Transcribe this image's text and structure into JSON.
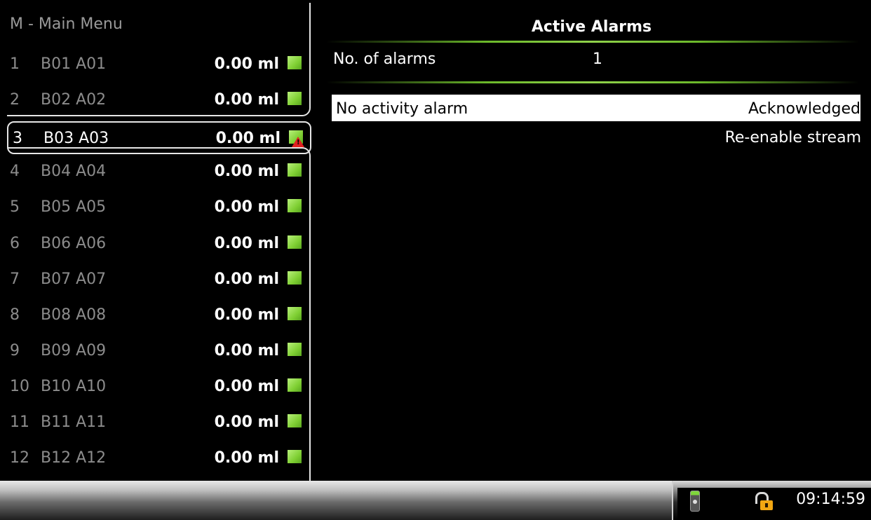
{
  "menu": {
    "title": "M - Main Menu",
    "items": [
      {
        "num": "1",
        "name": "B01 A01",
        "volume": "0.00 ml",
        "status": "ok"
      },
      {
        "num": "2",
        "name": "B02 A02",
        "volume": "0.00 ml",
        "status": "ok"
      },
      {
        "num": "3",
        "name": "B03 A03",
        "volume": "0.00 ml",
        "status": "alarm",
        "selected": true
      },
      {
        "num": "4",
        "name": "B04 A04",
        "volume": "0.00 ml",
        "status": "ok"
      },
      {
        "num": "5",
        "name": "B05 A05",
        "volume": "0.00 ml",
        "status": "ok"
      },
      {
        "num": "6",
        "name": "B06 A06",
        "volume": "0.00 ml",
        "status": "ok"
      },
      {
        "num": "7",
        "name": "B07 A07",
        "volume": "0.00 ml",
        "status": "ok"
      },
      {
        "num": "8",
        "name": "B08 A08",
        "volume": "0.00 ml",
        "status": "ok"
      },
      {
        "num": "9",
        "name": "B09 A09",
        "volume": "0.00 ml",
        "status": "ok"
      },
      {
        "num": "10",
        "name": "B10 A10",
        "volume": "0.00 ml",
        "status": "ok"
      },
      {
        "num": "11",
        "name": "B11 A11",
        "volume": "0.00 ml",
        "status": "ok"
      },
      {
        "num": "12",
        "name": "B12 A12",
        "volume": "0.00 ml",
        "status": "ok"
      }
    ]
  },
  "alarms": {
    "title": "Active Alarms",
    "count_label": "No. of alarms",
    "count_value": "1",
    "list": [
      {
        "name": "No activity alarm",
        "status": "Acknowledged"
      }
    ],
    "action": "Re-enable stream"
  },
  "statusbar": {
    "time": "09:14:59",
    "icons": [
      "device-icon",
      "lock-icon"
    ]
  },
  "colors": {
    "indicator_ok": "#7fcf33",
    "alarm": "#e02020",
    "lock": "#f2a712",
    "separator": "#8fd14a"
  }
}
